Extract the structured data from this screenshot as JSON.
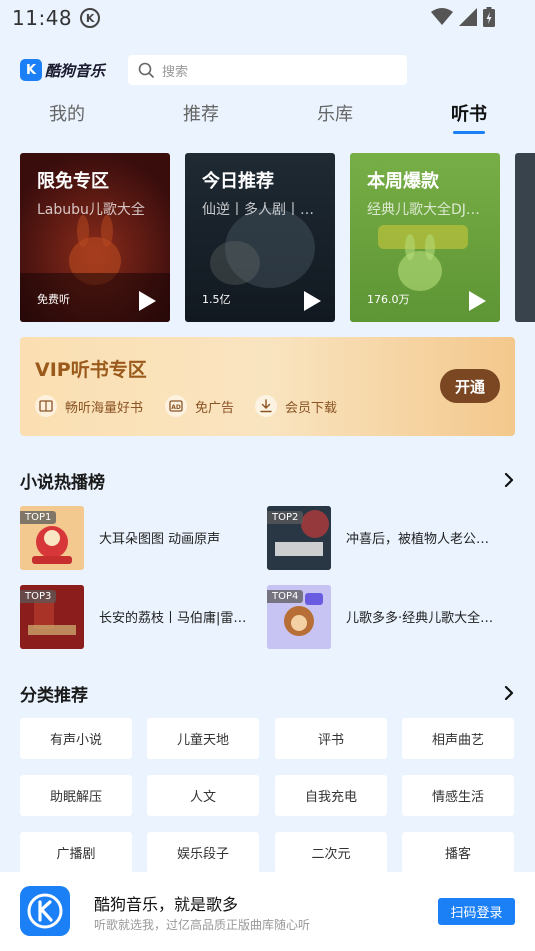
{
  "status": {
    "time": "11:48",
    "k_badge": "K"
  },
  "header": {
    "logo_text": "酷狗音乐",
    "logo_letter": "K",
    "search_placeholder": "搜索"
  },
  "tabs": [
    {
      "label": "我的"
    },
    {
      "label": "推荐"
    },
    {
      "label": "乐库"
    },
    {
      "label": "听书"
    }
  ],
  "active_tab": "听书",
  "cards": [
    {
      "title": "限免专区",
      "subtitle": "Labubu儿歌大全",
      "stat": "免费听",
      "color": "#4a1414"
    },
    {
      "title": "今日推荐",
      "subtitle": "仙逆丨多人剧丨曲…",
      "stat": "1.5亿",
      "color": "#1e2630"
    },
    {
      "title": "本周爆款",
      "subtitle": "经典儿歌大全DJ版…",
      "stat": "176.0万",
      "color": "#6ea53f"
    }
  ],
  "vip": {
    "title": "VIP听书专区",
    "features": [
      "畅听海量好书",
      "免广告",
      "会员下载"
    ],
    "button": "开通"
  },
  "ranking": {
    "title": "小说热播榜",
    "items": [
      {
        "badge": "TOP1",
        "title": "大耳朵图图 动画原声"
      },
      {
        "badge": "TOP2",
        "title": "冲喜后，被植物人老公夜…"
      },
      {
        "badge": "TOP3",
        "title": "长安的荔枝丨马伯庸|雷佳…"
      },
      {
        "badge": "TOP4",
        "title": "儿歌多多·经典儿歌大全丨…"
      }
    ]
  },
  "categories": {
    "title": "分类推荐",
    "items": [
      "有声小说",
      "儿童天地",
      "评书",
      "相声曲艺",
      "助眠解压",
      "人文",
      "自我充电",
      "情感生活",
      "广播剧",
      "娱乐段子",
      "二次元",
      "播客"
    ]
  },
  "bottom": {
    "title": "酷狗音乐，就是歌多",
    "subtitle": "听歌就选我，过亿高品质正版曲库随心听",
    "button": "扫码登录"
  },
  "colors": {
    "accent": "#1b7ff6",
    "vip_text": "#9a5a1b",
    "vip_button": "#7a4722",
    "background": "#eaf3fe"
  }
}
